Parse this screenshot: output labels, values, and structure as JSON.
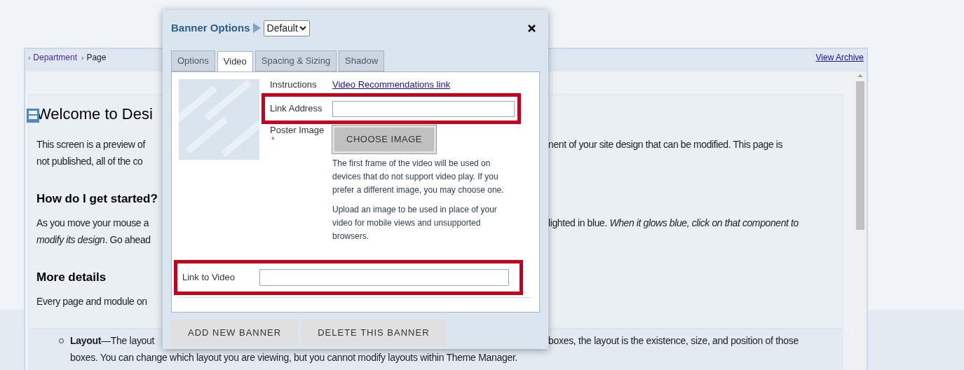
{
  "page": {
    "breadcrumb": [
      {
        "separator": "›",
        "label": "Department"
      },
      {
        "separator": "›",
        "label": "Page"
      }
    ],
    "archive_link": "View Archive",
    "rows": [
      {
        "kind": "heading1",
        "left": "Welcome to Desi",
        "right": ""
      },
      {
        "kind": "text",
        "left": "This screen is a preview of",
        "right": "nent of your site design that can be modified. This page is"
      },
      {
        "kind": "text",
        "left": "not published, all of the co",
        "right": ""
      },
      {
        "kind": "heading2",
        "left": "How do I get started?",
        "right": ""
      },
      {
        "kind": "text",
        "left": "As you move your mouse a",
        "right": "lighted in blue. *When it glows blue, click on that component to*"
      },
      {
        "kind": "text",
        "left": "*modify its design*. Go ahead",
        "right": ""
      },
      {
        "kind": "heading2",
        "left": "More details",
        "right": ""
      },
      {
        "kind": "text",
        "left": "Every page and module on",
        "right": ""
      }
    ],
    "list": [
      {
        "left": "**Layout**—The layout",
        "right": "boxes, the layout is the existence, size, and position of those",
        "line2": "boxes. You can change which layout you are viewing, but you cannot modify layouts within Theme Manager."
      }
    ]
  },
  "dialog": {
    "title": "Banner Options",
    "preset": "Default",
    "tabs": [
      {
        "label": "Options",
        "selected": false
      },
      {
        "label": "Video",
        "selected": true
      },
      {
        "label": "Spacing & Sizing",
        "selected": false
      },
      {
        "label": "Shadow",
        "selected": false
      }
    ],
    "instructions_label": "Instructions",
    "instructions_link": "Video Recommendations link",
    "link_address_label": "Link Address",
    "poster_label": "Poster Image",
    "required_mark": "*",
    "choose_button": "CHOOSE IMAGE",
    "poster_help": [
      "The first frame of the video will be used on devices that do not support video play. If you prefer a different image, you may choose one.",
      "Upload an image to be used in place of your video for mobile views and unsupported browsers."
    ],
    "link_video_label": "Link to Video",
    "buttons": [
      "ADD NEW BANNER",
      "DELETE THIS BANNER"
    ]
  }
}
